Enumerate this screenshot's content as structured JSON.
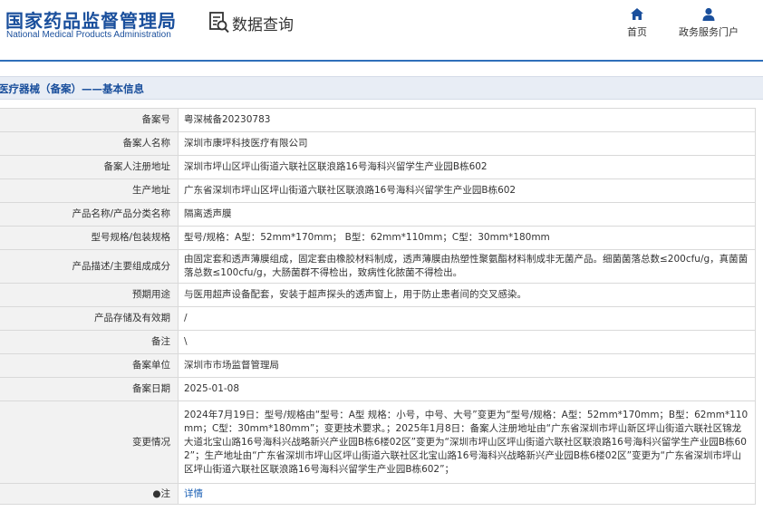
{
  "header": {
    "logo_cn": "国家药品监督管理局",
    "logo_en": "National Medical Products Administration",
    "system_title": "数据查询",
    "nav": {
      "home": "首页",
      "portal": "政务服务门户"
    }
  },
  "section": {
    "title": "医疗器械（备案）——基本信息"
  },
  "fields": {
    "record_no": {
      "label": "备案号",
      "value": "粤深械备20230783"
    },
    "filer_name": {
      "label": "备案人名称",
      "value": "深圳市康坪科技医疗有限公司"
    },
    "filer_address": {
      "label": "备案人注册地址",
      "value": "深圳市坪山区坪山街道六联社区联浪路16号海科兴留学生产业园B栋602"
    },
    "production_address": {
      "label": "生产地址",
      "value": "广东省深圳市坪山区坪山街道六联社区联浪路16号海科兴留学生产业园B栋602"
    },
    "product_name": {
      "label": "产品名称/产品分类名称",
      "value": "隔离透声膜"
    },
    "model_spec": {
      "label": "型号规格/包装规格",
      "value": "型号/规格：A型：52mm*170mm； B型：62mm*110mm；C型：30mm*180mm"
    },
    "description": {
      "label": "产品描述/主要组成成分",
      "value": "由固定套和透声薄膜组成，固定套由橡胶材料制成，透声薄膜由热塑性聚氨酯材料制成非无菌产品。细菌菌落总数≤200cfu/g，真菌菌落总数≤100cfu/g，大肠菌群不得检出，致病性化脓菌不得检出。"
    },
    "intended_use": {
      "label": "预期用途",
      "value": "与医用超声设备配套，安装于超声探头的透声窗上，用于防止患者间的交叉感染。"
    },
    "storage": {
      "label": "产品存储及有效期",
      "value": "/"
    },
    "remarks": {
      "label": "备注",
      "value": "\\"
    },
    "record_unit": {
      "label": "备案单位",
      "value": "深圳市市场监督管理局"
    },
    "record_date": {
      "label": "备案日期",
      "value": "2025-01-08"
    },
    "changes": {
      "label": "变更情况",
      "value": "2024年7月19日：型号/规格由“型号：A型 规格：小号，中号、大号”变更为“型号/规格：A型：52mm*170mm；B型：62mm*110mm；C型：30mm*180mm”；变更技术要求。；2025年1月8日：备案人注册地址由“广东省深圳市坪山新区坪山街道六联社区锦龙大道北宝山路16号海科兴战略新兴产业园B栋6楼02区”变更为“深圳市坪山区坪山街道六联社区联浪路16号海科兴留学生产业园B栋602”；生产地址由“广东省深圳市坪山区坪山街道六联社区北宝山路16号海科兴战略新兴产业园B栋6楼02区”变更为“广东省深圳市坪山区坪山街道六联社区联浪路16号海科兴留学生产业园B栋602”；"
    },
    "note": {
      "label": "●注",
      "value": "详情"
    }
  },
  "colors": {
    "brand_blue": "#1a4f9c",
    "link_blue": "#1a5fb4",
    "label_bg": "#f2f2f2",
    "section_bg": "#e8edf5"
  },
  "icons": {
    "system": "search-document-icon",
    "home": "home-icon",
    "portal": "user-icon"
  }
}
